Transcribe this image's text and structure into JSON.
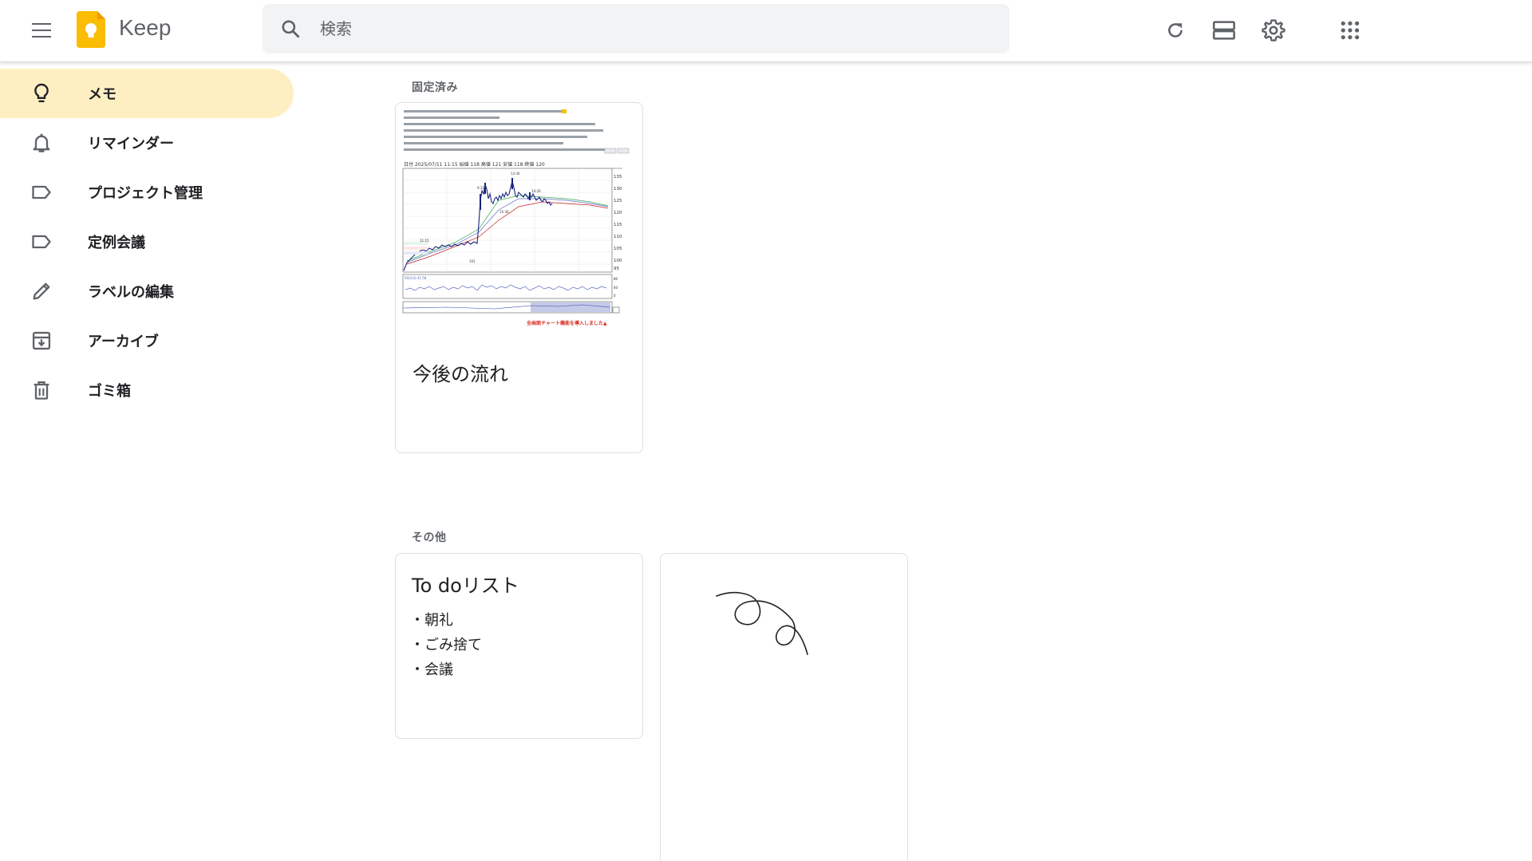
{
  "app": {
    "title": "Keep"
  },
  "search": {
    "placeholder": "検索",
    "value": ""
  },
  "header_icons": [
    "refresh-icon",
    "list-view-icon",
    "settings-icon",
    "apps-grid-icon"
  ],
  "sidebar": {
    "items": [
      {
        "label": "メモ",
        "icon": "lightbulb-icon",
        "active": true
      },
      {
        "label": "リマインダー",
        "icon": "bell-icon",
        "active": false
      },
      {
        "label": "プロジェクト管理",
        "icon": "label-icon",
        "active": false
      },
      {
        "label": "定例会議",
        "icon": "label-icon",
        "active": false
      },
      {
        "label": "ラベルの編集",
        "icon": "pencil-icon",
        "active": false
      },
      {
        "label": "アーカイブ",
        "icon": "archive-icon",
        "active": false
      },
      {
        "label": "ゴミ箱",
        "icon": "trash-icon",
        "active": false
      }
    ]
  },
  "pinned": {
    "section_title": "固定済み",
    "notes": [
      {
        "title": "今後の流れ",
        "image": {
          "header_text": "日付 2025/07/11 11:15 始値 118 高値 121 安値 118 終値 120",
          "footer_text": "全画面チャート機能を導入しました▲",
          "price_labels": [
            "135",
            "130",
            "125",
            "120",
            "115",
            "110",
            "105",
            "100",
            "95"
          ]
        }
      }
    ]
  },
  "others": {
    "section_title": "その他",
    "notes": [
      {
        "title": "To doリスト",
        "items": [
          "朝礼",
          "ごみ捨て",
          "会議"
        ]
      },
      {
        "title": "",
        "drawing": true
      }
    ]
  },
  "colors": {
    "active_nav": "#feefc3",
    "logo": "#fbbc04",
    "icon": "#5f6368"
  }
}
